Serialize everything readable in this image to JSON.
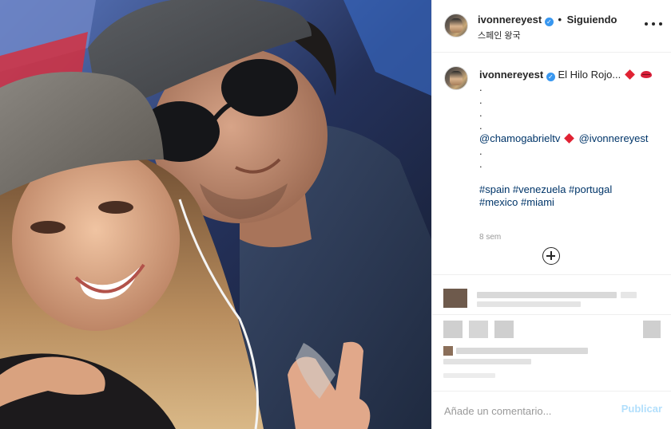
{
  "post": {
    "author": {
      "username": "ivonnereyest",
      "verified_icon": "verified-check-icon",
      "follow_separator": "•",
      "follow_status": "Siguiendo",
      "location": "스페인 왕국"
    },
    "caption": {
      "username": "ivonnereyest",
      "text": "El Hilo Rojo...",
      "emoji_after_text": [
        "red-diamond-icon",
        "lips-icon"
      ],
      "dot_lines": [
        ".",
        ".",
        ".",
        "."
      ],
      "mention_1": "@chamogabrieltv",
      "mention_2": "@ivonnereyest",
      "dot_lines_2": [
        ".",
        "."
      ],
      "hashtags_line_1": "#spain #venezuela #portugal",
      "hashtags_line_2": "#mexico #miami"
    },
    "timestamp": "8 sem",
    "load_more_icon": "plus-circle-icon",
    "comment_box": {
      "placeholder": "Añade un comentario...",
      "publish_label": "Publicar"
    },
    "colors": {
      "link": "#003569",
      "verified": "#3897f0",
      "publish_disabled": "#b2dffc",
      "muted": "#999999"
    }
  }
}
